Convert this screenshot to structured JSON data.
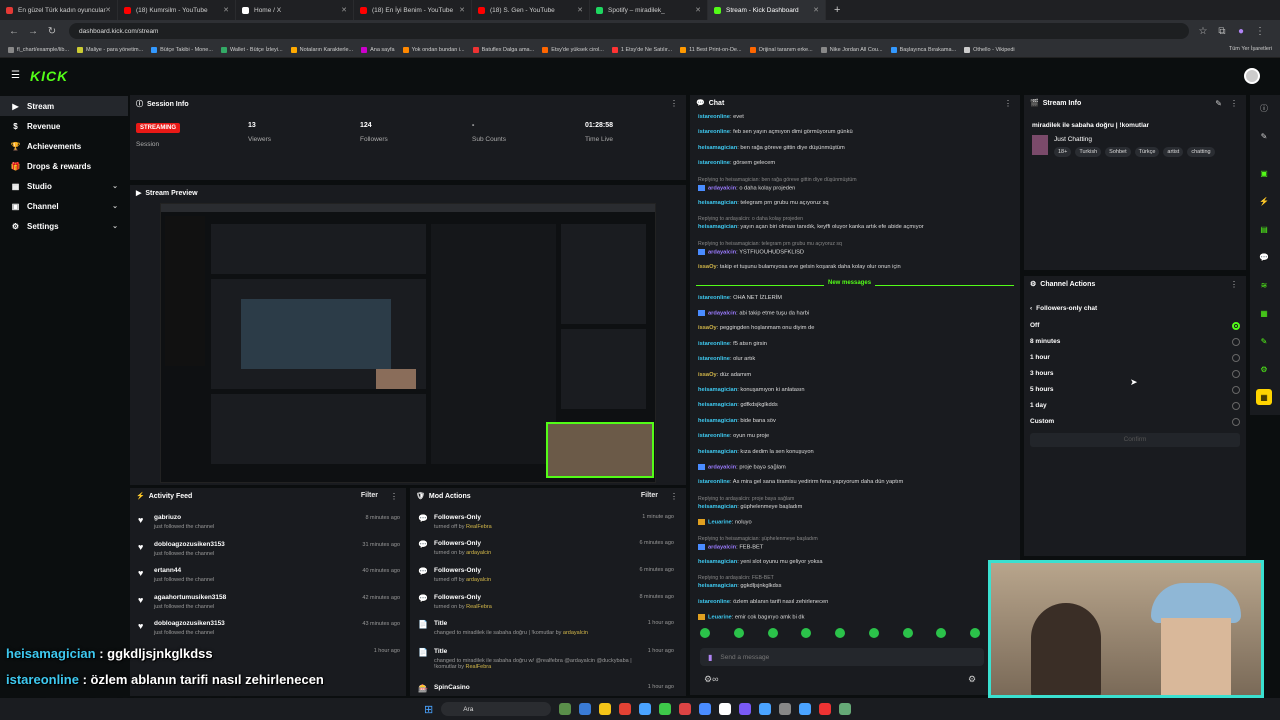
{
  "browser": {
    "tabs": [
      {
        "label": "En güzel Türk kadın oyuncular",
        "color": "#e53935"
      },
      {
        "label": "(18) Kumrsilm - YouTube",
        "color": "#ff0000"
      },
      {
        "label": "Home / X",
        "color": "#ffffff"
      },
      {
        "label": "(18) En İyi Benim - YouTube",
        "color": "#ff0000"
      },
      {
        "label": "(18) S. Gen - YouTube",
        "color": "#ff0000"
      },
      {
        "label": "Spotify – miradilek_",
        "color": "#1ed760"
      },
      {
        "label": "Stream - Kick Dashboard",
        "color": "#53fc18"
      }
    ],
    "url": "dashboard.kick.com/stream",
    "bookmarks": [
      "fl_chart/example/lib...",
      "Maliye - para yönetim...",
      "Bütçe Takibi - Mone...",
      "Wallet - Bütçe İzleyi...",
      "Notaların Karakterle...",
      "Ana sayfa",
      "Yok ondan bundan i...",
      "Batuflex Dalga ama...",
      "Etsy'de yüksek cirol...",
      "1 Etsy'de Ne Satılır...",
      "11 Best Print-on-De...",
      "Orijinal taranım erke...",
      "Nike Jordan All Cou...",
      "Başlayınca Bırakama...",
      "Othello - Vikipedi"
    ],
    "all_bookmarks": "Tüm Yer İşaretleri"
  },
  "brand": {
    "logo": "KICK",
    "accent": "#53fc18"
  },
  "sidebar": {
    "items": [
      {
        "label": "Stream",
        "icon": "video-icon",
        "active": true
      },
      {
        "label": "Revenue",
        "icon": "dollar-icon"
      },
      {
        "label": "Achievements",
        "icon": "trophy-icon"
      },
      {
        "label": "Drops & rewards",
        "icon": "gift-icon"
      },
      {
        "label": "Studio",
        "icon": "studio-icon",
        "expand": true
      },
      {
        "label": "Channel",
        "icon": "channel-icon",
        "expand": true
      },
      {
        "label": "Settings",
        "icon": "gear-icon",
        "expand": true
      }
    ]
  },
  "session": {
    "title": "Session Info",
    "status": "STREAMING",
    "status_label": "Session",
    "stats": [
      {
        "value": "13",
        "label": "Viewers"
      },
      {
        "value": "124",
        "label": "Followers"
      },
      {
        "value": "-",
        "label": "Sub Counts"
      },
      {
        "value": "01:28:58",
        "label": "Time Live"
      }
    ]
  },
  "preview": {
    "title": "Stream Preview"
  },
  "activity": {
    "title": "Activity Feed",
    "filter": "Filter",
    "items": [
      {
        "user": "gabriuzo",
        "sub": "just followed the channel",
        "time": "8 minutes ago"
      },
      {
        "user": "dobloagzozusiken3153",
        "sub": "just followed the channel",
        "time": "31 minutes ago"
      },
      {
        "user": "ertann44",
        "sub": "just followed the channel",
        "time": "40 minutes ago"
      },
      {
        "user": "agaahortumusiken3158",
        "sub": "just followed the channel",
        "time": "42 minutes ago"
      },
      {
        "user": "dobloagzozusiken3153",
        "sub": "just followed the channel",
        "time": "43 minutes ago"
      },
      {
        "user": "",
        "sub": "",
        "time": "1 hour ago"
      }
    ]
  },
  "mod": {
    "title": "Mod Actions",
    "filter": "Filter",
    "items": [
      {
        "title": "Followers-Only",
        "sub": "turned off by",
        "by": "RealFebra",
        "time": "1 minute ago"
      },
      {
        "title": "Followers-Only",
        "sub": "turned on by",
        "by": "ardayalcin",
        "time": "6 minutes ago"
      },
      {
        "title": "Followers-Only",
        "sub": "turned off by",
        "by": "ardayalcin",
        "time": "6 minutes ago"
      },
      {
        "title": "Followers-Only",
        "sub": "turned on by",
        "by": "RealFebra",
        "time": "8 minutes ago"
      },
      {
        "title": "Title",
        "sub": "changed to miradilek ile sabaha doğru | !komutlar by",
        "by": "ardayalcin",
        "time": "1 hour ago"
      },
      {
        "title": "Title",
        "sub": "changed to miradilek ile sabaha doğru w/ @realfebra @ardayalcin @duckybaba | !komutlar by",
        "by": "RealFebra",
        "time": "1 hour ago"
      },
      {
        "title": "SpinCasino",
        "sub": "",
        "by": "",
        "time": "1 hour ago"
      }
    ]
  },
  "chat": {
    "title": "Chat",
    "new_messages": "New messages",
    "placeholder": "Send a message",
    "lines": [
      {
        "type": "msg",
        "user": "istareonline",
        "color": "#3ec9f0",
        "text": "evet"
      },
      {
        "type": "msg",
        "user": "istareonline",
        "color": "#3ec9f0",
        "text": "feb sen yayın açmıyon dimi görmüyorum günkü"
      },
      {
        "type": "msg",
        "user": "heisamagician",
        "color": "#3ec9f0",
        "text": "ben rağa göreve gittin diye düşünmüştüm"
      },
      {
        "type": "msg",
        "user": "istareonline",
        "color": "#3ec9f0",
        "text": "görsem gelecem"
      },
      {
        "type": "reply",
        "text": "Replying to heisamagician: ben rağa göreve gittin diye düşünmüştüm"
      },
      {
        "type": "msg",
        "user": "ardayalcin",
        "color": "#9b7bff",
        "text": "o daha kolay projeden",
        "badge": true
      },
      {
        "type": "msg",
        "user": "heisamagician",
        "color": "#3ec9f0",
        "text": "telegram prn grubu mu açıyoruz sq"
      },
      {
        "type": "reply",
        "text": "Replying to ardayalcin: o daha kolay projeden"
      },
      {
        "type": "msg",
        "user": "heisamagician",
        "color": "#3ec9f0",
        "text": "yayın açan biri olması tanıdık, keyffi oluyor kanka artık efe abide açmıyor"
      },
      {
        "type": "reply",
        "text": "Replying to heisamagician: telegram prn grubu mu açıyoruz sq"
      },
      {
        "type": "msg",
        "user": "ardayalcin",
        "color": "#9b7bff",
        "text": "YSTFIUOUHUDSFKLISD",
        "badge": true
      },
      {
        "type": "msg",
        "user": "issaOy",
        "color": "#d4b84a",
        "text": "takip et tuşunu bulamıyosa eve gelsin koşarak daha kolay olur onun için"
      },
      {
        "type": "new"
      },
      {
        "type": "msg",
        "user": "istareonline",
        "color": "#3ec9f0",
        "text": "OHA NET İZLERİM"
      },
      {
        "type": "msg",
        "user": "ardayalcin",
        "color": "#9b7bff",
        "text": "abi takip etme tuşu da harbi",
        "badge": true
      },
      {
        "type": "msg",
        "user": "issaOy",
        "color": "#d4b84a",
        "text": "peggingden hoşlanmam onu diyim de"
      },
      {
        "type": "msg",
        "user": "istareonline",
        "color": "#3ec9f0",
        "text": "f5 atsın girsin"
      },
      {
        "type": "msg",
        "user": "istareonline",
        "color": "#3ec9f0",
        "text": "olur artık"
      },
      {
        "type": "msg",
        "user": "issaOy",
        "color": "#d4b84a",
        "text": "düz adamım"
      },
      {
        "type": "msg",
        "user": "heisamagician",
        "color": "#3ec9f0",
        "text": "konuşamıyon ki anlatasın"
      },
      {
        "type": "msg",
        "user": "heisamagician",
        "color": "#3ec9f0",
        "text": "gdfkdsjkglkdds"
      },
      {
        "type": "msg",
        "user": "heisamagician",
        "color": "#3ec9f0",
        "text": "bide bana söv"
      },
      {
        "type": "msg",
        "user": "istareonline",
        "color": "#3ec9f0",
        "text": "oyun mu proje"
      },
      {
        "type": "msg",
        "user": "heisamagician",
        "color": "#3ec9f0",
        "text": "kıza dedim la sen konuşuyon"
      },
      {
        "type": "msg",
        "user": "ardayalcin",
        "color": "#9b7bff",
        "text": "proje bayə sağlam",
        "badge": true
      },
      {
        "type": "msg",
        "user": "istareonline",
        "color": "#3ec9f0",
        "text": "As mira gel sana tiramisu yedirirm fena yapıyorum daha dün yaptım"
      },
      {
        "type": "reply",
        "text": "Replying to ardayalcin: proje baya sağlam"
      },
      {
        "type": "msg",
        "user": "heisamagician",
        "color": "#3ec9f0",
        "text": "güphelenmeye başladım"
      },
      {
        "type": "msg",
        "user": "Leuarine",
        "color": "#3ec9f0",
        "text": "noluyo",
        "badge": true
      },
      {
        "type": "reply",
        "text": "Replying to heisamagician: şüphelenmeye başladım"
      },
      {
        "type": "msg",
        "user": "ardayalcin",
        "color": "#9b7bff",
        "text": "FEB-BET",
        "badge": true
      },
      {
        "type": "msg",
        "user": "heisamagician",
        "color": "#3ec9f0",
        "text": "yeni slot oyunu mu geliyor yoksa"
      },
      {
        "type": "reply",
        "text": "Replying to ardayalcin: FEB-BET"
      },
      {
        "type": "msg",
        "user": "heisamagician",
        "color": "#3ec9f0",
        "text": "ggkdljsjnkglkdss"
      },
      {
        "type": "msg",
        "user": "istareonline",
        "color": "#3ec9f0",
        "text": "özlem ablanın tarifi nasıl zehirlenecen"
      },
      {
        "type": "msg",
        "user": "Leuarine",
        "color": "#3ec9f0",
        "text": "emir cok bagırıyo amk bi dk",
        "badge": true
      }
    ]
  },
  "stream_info": {
    "title": "Stream Info",
    "stream_title": "miradilek ile sabaha doğru | !komutlar",
    "category": "Just Chatting",
    "tags": [
      "18+",
      "Turkish",
      "Sohbet",
      "Türkçe",
      "artist",
      "chatting"
    ]
  },
  "channel_actions": {
    "title": "Channel Actions",
    "section": "Followers-only chat",
    "options": [
      "Off",
      "8 minutes",
      "1 hour",
      "3 hours",
      "5 hours",
      "1 day",
      "Custom"
    ],
    "selected": 0,
    "confirm": "Confirm"
  },
  "overlay_chat": [
    {
      "user": "heisamagician",
      "color": "#3ec9f0",
      "text": "ggkdljsjnkglkdss"
    },
    {
      "user": "istareonline",
      "color": "#3ec9f0",
      "text": "özlem ablanın tarifi nasıl zehirlenecen"
    },
    {
      "user": "Leuarine",
      "color": "#c49a3a",
      "text": "emir cok bagırıyo amk bi dk"
    }
  ],
  "taskbar": {
    "search": "Ara"
  }
}
